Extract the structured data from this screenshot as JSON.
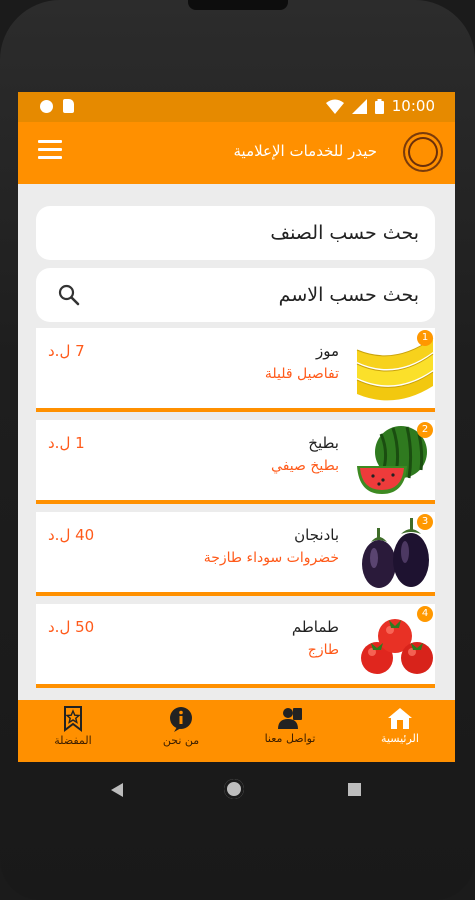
{
  "status_bar": {
    "time": "10:00"
  },
  "app_bar": {
    "title": "حيدر للخدمات الإعلامية"
  },
  "search": {
    "by_category": "بحث حسب الصنف",
    "by_name": "بحث حسب الاسم"
  },
  "products": [
    {
      "badge": "1",
      "name": "موز",
      "description": "تفاصيل قليلة",
      "price": "7 ل.د"
    },
    {
      "badge": "2",
      "name": "بطيخ",
      "description": "بطيخ صيفي",
      "price": "1 ل.د"
    },
    {
      "badge": "3",
      "name": "بادنجان",
      "description": "خضروات سوداء طازجة",
      "price": "40 ل.د"
    },
    {
      "badge": "4",
      "name": "طماطم",
      "description": "طازج",
      "price": "50 ل.د"
    }
  ],
  "bottom_nav": [
    {
      "label": "الرئيسية",
      "icon": "home-icon",
      "active": true
    },
    {
      "label": "تواصل معنا",
      "icon": "contact-icon",
      "active": false
    },
    {
      "label": "من نحن",
      "icon": "info-icon",
      "active": false
    },
    {
      "label": "المفضلة",
      "icon": "favorite-icon",
      "active": false
    }
  ],
  "colors": {
    "primary": "#ff9000",
    "status_bar": "#e68a00",
    "accent_text": "#ff5a1a",
    "background": "#ececec"
  }
}
